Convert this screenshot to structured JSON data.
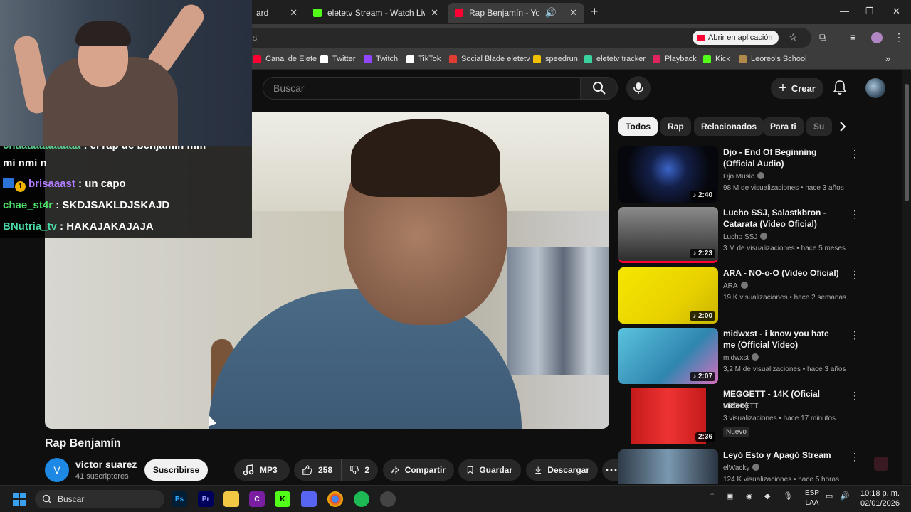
{
  "browser": {
    "tabs": [
      {
        "label": "ard",
        "favicon_color": "#1f1f1f"
      },
      {
        "label": "eletetv Stream - Watch Live on",
        "favicon_color": "#53fc18"
      },
      {
        "label": "Rap Benjamín - YouTube",
        "favicon_color": "#ff0033"
      }
    ],
    "omnibox_text": "ls",
    "open_in_app": "Abrir en aplicación",
    "bookmarks": [
      {
        "label": "Canal de Elete",
        "icon": "youtube-icon",
        "color": "#ff0033"
      },
      {
        "label": "Twitter",
        "icon": "x-icon",
        "color": "#ffffff"
      },
      {
        "label": "Twitch",
        "icon": "twitch-icon",
        "color": "#9146ff"
      },
      {
        "label": "TikTok",
        "icon": "tiktok-icon",
        "color": "#ffffff"
      },
      {
        "label": "Social Blade eletetv",
        "icon": "socialblade-icon",
        "color": "#e03c31"
      },
      {
        "label": "speedrun",
        "icon": "speedrun-icon",
        "color": "#f0c000"
      },
      {
        "label": "eletetv tracker",
        "icon": "tracker-icon",
        "color": "#3ad29f"
      },
      {
        "label": "Playback",
        "icon": "playback-icon",
        "color": "#e0245e"
      },
      {
        "label": "Kick",
        "icon": "kick-icon",
        "color": "#53fc18"
      },
      {
        "label": "Leoreo's School",
        "icon": "school-icon",
        "color": "#b08a4a"
      }
    ]
  },
  "youtube": {
    "search_placeholder": "Buscar",
    "create_label": "Crear",
    "video_title": "Rap Benjamín",
    "channel_initial": "V",
    "channel_name": "victor suarez",
    "channel_subs": "41 suscriptores",
    "subscribe_label": "Suscribirse",
    "actions": {
      "mp3": "MP3",
      "likes": "258",
      "dislikes": "2",
      "share": "Compartir",
      "save": "Guardar",
      "download": "Descargar"
    },
    "chips": [
      "Todos",
      "Rap",
      "Relacionados",
      "Para ti",
      "Su"
    ],
    "recommendations": [
      {
        "title": "Djo - End Of Beginning (Official Audio)",
        "channel": "Djo Music",
        "meta": "98 M de visualizaciones • hace 3 años",
        "duration": "2:40",
        "thumb": "#0b0d18",
        "verified": true
      },
      {
        "title": "Lucho SSJ, Salastkbron - Catarata (Video Oficial)",
        "channel": "Lucho SSJ",
        "meta": "3 M de visualizaciones • hace 5 meses",
        "duration": "2:23",
        "thumb": "#5a5a5a",
        "verified": true
      },
      {
        "title": "ARA - NO-o-O (Video Oficial)",
        "channel": "ARA",
        "meta": "19 K visualizaciones • hace 2 semanas",
        "duration": "2:00",
        "thumb": "#f0e000",
        "verified": true
      },
      {
        "title": "midwxst - i know you hate me (Official Video)",
        "channel": "midwxst",
        "meta": "3,2 M de visualizaciones • hace 3 años",
        "duration": "2:07",
        "thumb": "#39a9c9",
        "verified": true
      },
      {
        "title": "MEGGETT - 14K (Oficial video)",
        "channel": "MEGGETT",
        "meta": "3 visualizaciones • hace 17 minutos",
        "duration": "2:36",
        "thumb": "#c41a1a",
        "verified": false,
        "badge": "Nuevo"
      },
      {
        "title": "Leyó Esto y Apagó Stream",
        "channel": "elWacky",
        "meta": "124 K visualizaciones • hace 5 horas",
        "duration": "",
        "thumb": "#4d7391",
        "verified": true
      }
    ]
  },
  "chat": {
    "messages": [
      {
        "user": "chaaaaaaaaaaa",
        "text": ": el rap de benjamin mm",
        "cont": "mi nmi n"
      },
      {
        "user": "brisaaast",
        "text": ": un capo"
      },
      {
        "user": "chae_st4r",
        "text": ": SKDJSAKLDJSKAJD"
      },
      {
        "user": "BNutria_tv",
        "text": ": HAKAJAKAJAJA"
      }
    ]
  },
  "taskbar": {
    "search_placeholder": "Buscar",
    "lang_top": "ESP",
    "lang_bottom": "LAA",
    "time": "10:18 p. m.",
    "date": "02/01/2026"
  }
}
